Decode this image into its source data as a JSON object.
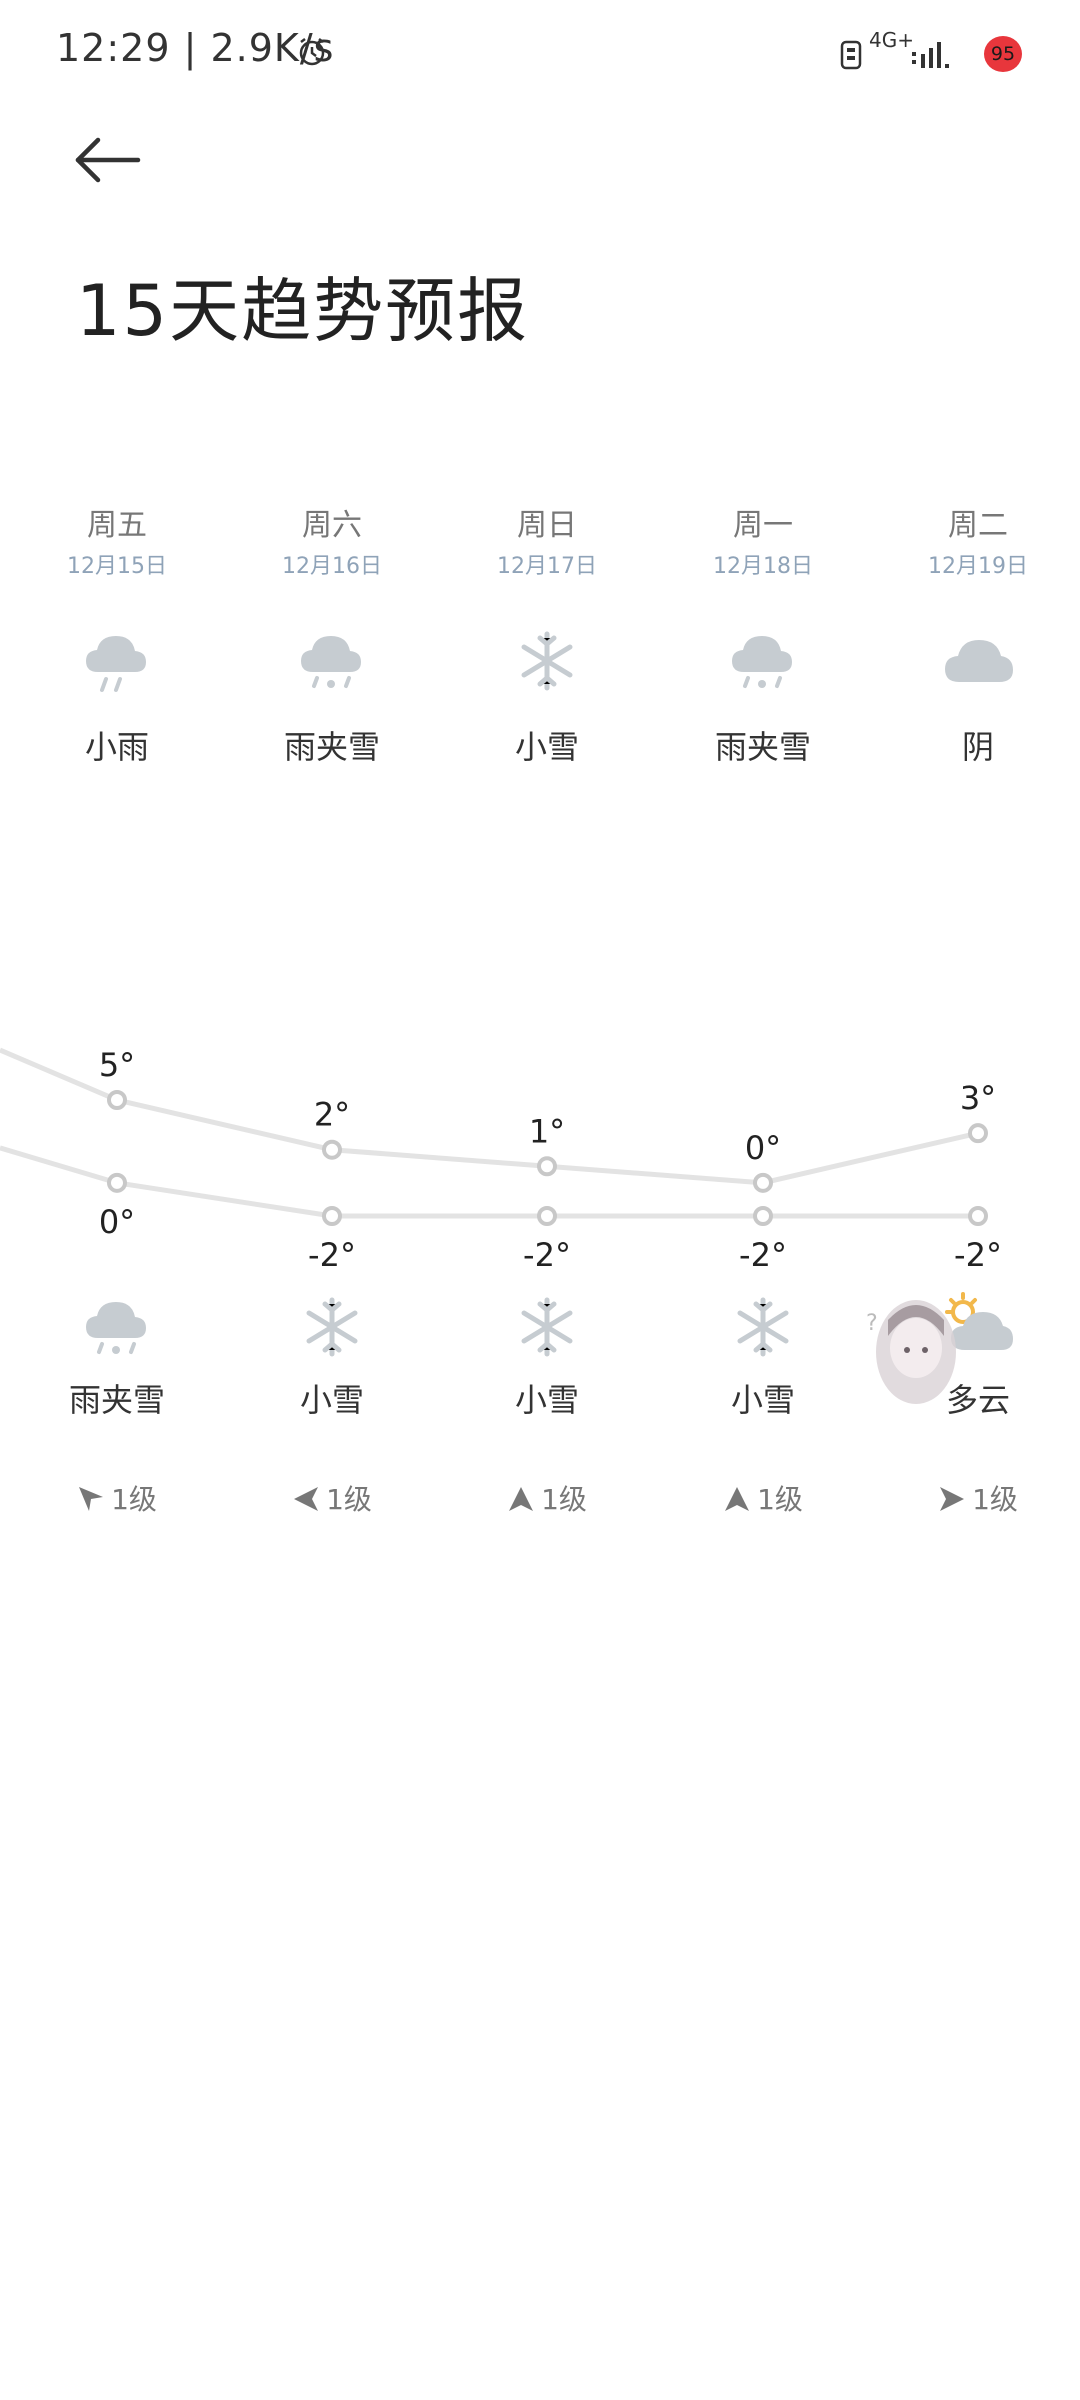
{
  "status_bar": {
    "time": "12:29 | 2.9K/s",
    "network_type": "4G+",
    "battery": "95",
    "icons": [
      "alarm-icon",
      "sim-icon",
      "signal-icon"
    ]
  },
  "header": {
    "back_icon": "back-arrow-icon",
    "title": "15天趋势预报"
  },
  "days": [
    {
      "weekday": "周五",
      "date": "12月15日",
      "day_condition": "小雨",
      "day_icon": "rain-icon",
      "high": "5°",
      "low": "0°",
      "night_condition": "雨夹雪",
      "night_icon": "sleet-icon",
      "wind": "1级",
      "wind_dir": "northwest"
    },
    {
      "weekday": "周六",
      "date": "12月16日",
      "day_condition": "雨夹雪",
      "day_icon": "sleet-icon",
      "high": "2°",
      "low": "-2°",
      "night_condition": "小雪",
      "night_icon": "snow-icon",
      "wind": "1级",
      "wind_dir": "west"
    },
    {
      "weekday": "周日",
      "date": "12月17日",
      "day_condition": "小雪",
      "day_icon": "snow-icon",
      "high": "1°",
      "low": "-2°",
      "night_condition": "小雪",
      "night_icon": "snow-icon",
      "wind": "1级",
      "wind_dir": "north"
    },
    {
      "weekday": "周一",
      "date": "12月18日",
      "day_condition": "雨夹雪",
      "day_icon": "sleet-icon",
      "high": "0°",
      "low": "-2°",
      "night_condition": "小雪",
      "night_icon": "snow-icon",
      "wind": "1级",
      "wind_dir": "north"
    },
    {
      "weekday": "周二",
      "date": "12月19日",
      "day_condition": "阴",
      "day_icon": "overcast-icon",
      "high": "3°",
      "low": "-2°",
      "night_condition": "多云",
      "night_icon": "partly-cloudy-icon",
      "wind": "1级",
      "wind_dir": "east"
    }
  ],
  "chart_data": {
    "type": "line",
    "categories": [
      "12月15日",
      "12月16日",
      "12月17日",
      "12月18日",
      "12月19日"
    ],
    "series": [
      {
        "values": [
          5,
          2,
          1,
          0,
          3
        ]
      },
      {
        "values": [
          0,
          -2,
          -2,
          -2,
          -2
        ]
      }
    ],
    "ylim": [
      -3,
      6
    ],
    "line_color": "#e3e3e3"
  },
  "colors": {
    "icon_gray": "#c6ccd1",
    "date_blue": "#8fa3b8",
    "sun_orange": "#f2b84b",
    "badge_red": "#e8363c"
  }
}
